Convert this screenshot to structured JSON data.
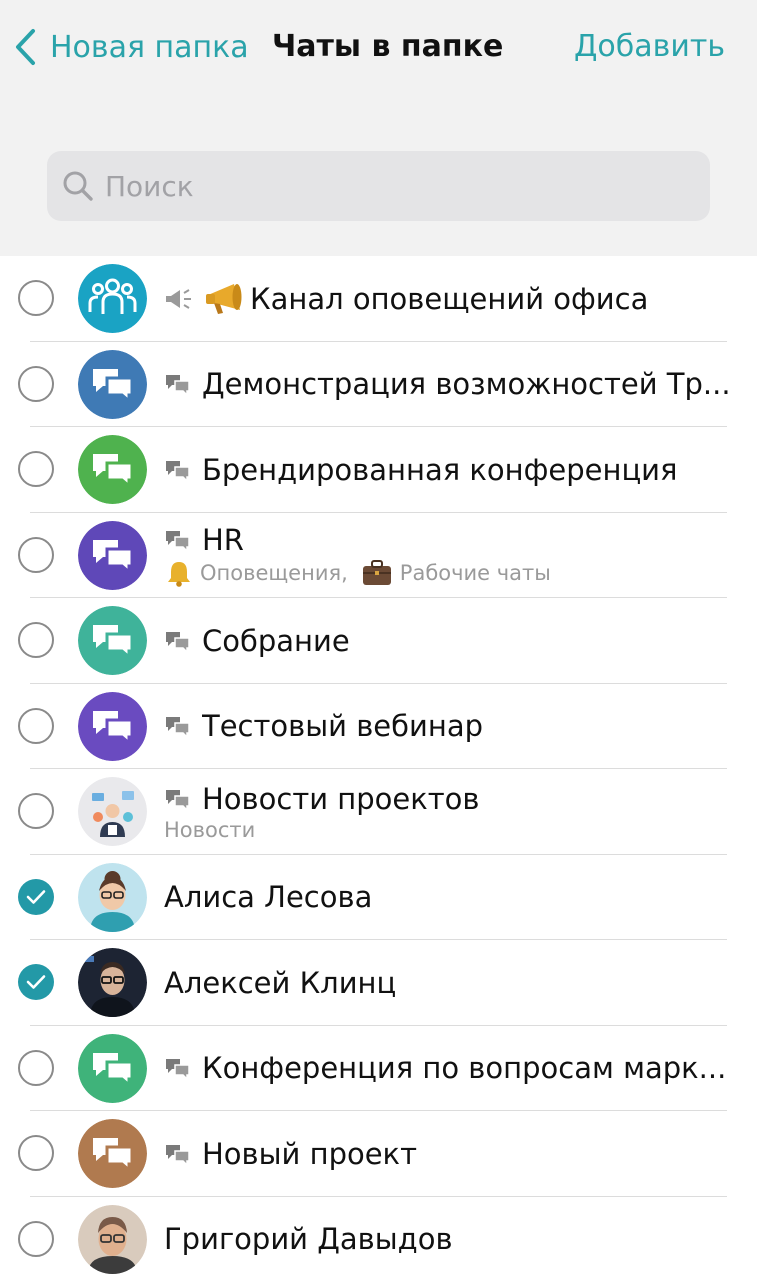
{
  "header": {
    "back_label": "Новая папка",
    "title": "Чаты в папке",
    "add_label": "Добавить",
    "accent_color": "#2aa3aa"
  },
  "search": {
    "placeholder": "Поиск",
    "value": ""
  },
  "chats": [
    {
      "name": "Канал оповещений офиса",
      "type": "channel",
      "checked": false,
      "avatar": "people-group-icon",
      "avatar_color": "#1aa3c4"
    },
    {
      "name": "Демонстрация возможностей Тр...",
      "type": "group",
      "checked": false,
      "avatar": "chat-bubbles-icon",
      "avatar_color": "#3f7ab5"
    },
    {
      "name": "Брендированная конференция",
      "type": "group",
      "checked": false,
      "avatar": "chat-bubbles-icon",
      "avatar_color": "#4fb24e"
    },
    {
      "name": "HR",
      "type": "group",
      "checked": false,
      "avatar": "chat-bubbles-icon",
      "avatar_color": "#5f48b8",
      "folders": [
        "Оповещения,",
        "Рабочие чаты"
      ]
    },
    {
      "name": "Собрание",
      "type": "group",
      "checked": false,
      "avatar": "chat-bubbles-icon",
      "avatar_color": "#3fb39a"
    },
    {
      "name": "Тестовый вебинар",
      "type": "group",
      "checked": false,
      "avatar": "chat-bubbles-icon",
      "avatar_color": "#6a4bc0"
    },
    {
      "name": "Новости проектов",
      "type": "group",
      "checked": false,
      "avatar": "news-image",
      "avatar_color": "#e8e8ea",
      "subtitle": "Новости"
    },
    {
      "name": "Алиса Лесова",
      "type": "person",
      "checked": true,
      "avatar": "photo-woman",
      "avatar_color": "#2f9fb0"
    },
    {
      "name": "Алексей Клинц",
      "type": "person",
      "checked": true,
      "avatar": "photo-man-dark",
      "avatar_color": "#1d2433"
    },
    {
      "name": "Конференция по вопросам марк...",
      "type": "group",
      "checked": false,
      "avatar": "chat-bubbles-icon",
      "avatar_color": "#3fb37a"
    },
    {
      "name": "Новый проект",
      "type": "group",
      "checked": false,
      "avatar": "chat-bubbles-icon",
      "avatar_color": "#b07a4f"
    },
    {
      "name": "Григорий Давыдов",
      "type": "person",
      "checked": false,
      "avatar": "photo-man",
      "avatar_color": "#7a5a48"
    }
  ]
}
